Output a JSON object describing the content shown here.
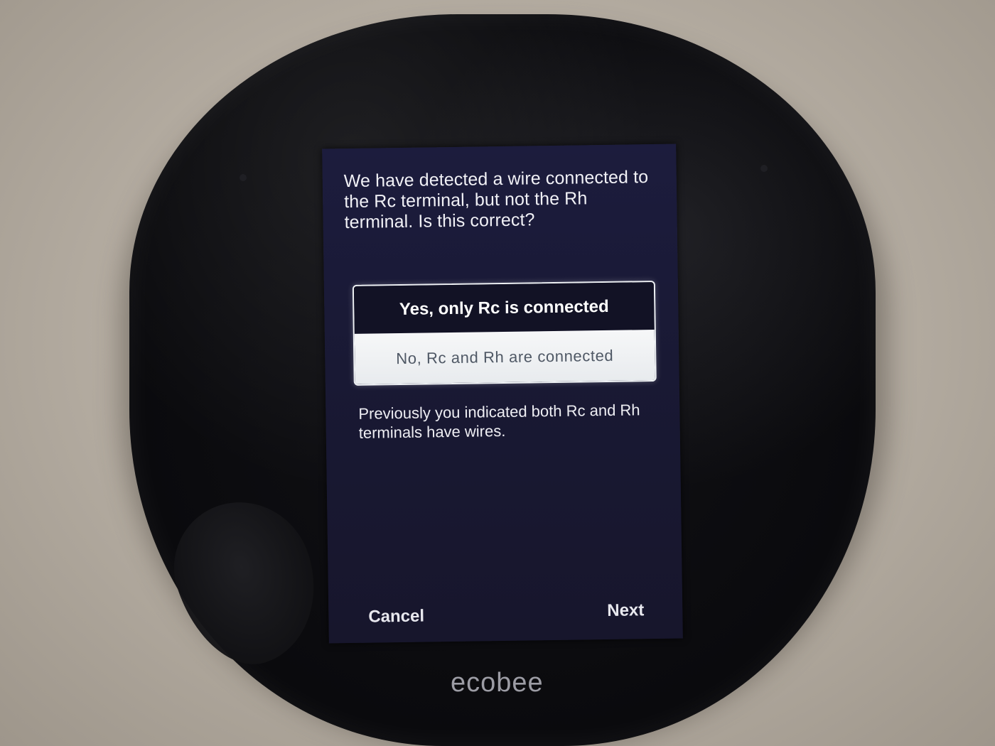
{
  "screen": {
    "question": "We have detected a wire connected to the Rc terminal, but not the Rh terminal.  Is this correct?",
    "options": [
      {
        "label": "Yes, only Rc is connected",
        "selected": true
      },
      {
        "label": "No, Rc and Rh are connected",
        "selected": false
      }
    ],
    "note": "Previously you indicated both Rc and Rh terminals have wires.",
    "cancel_label": "Cancel",
    "next_label": "Next"
  },
  "device": {
    "brand": "ecobee"
  }
}
